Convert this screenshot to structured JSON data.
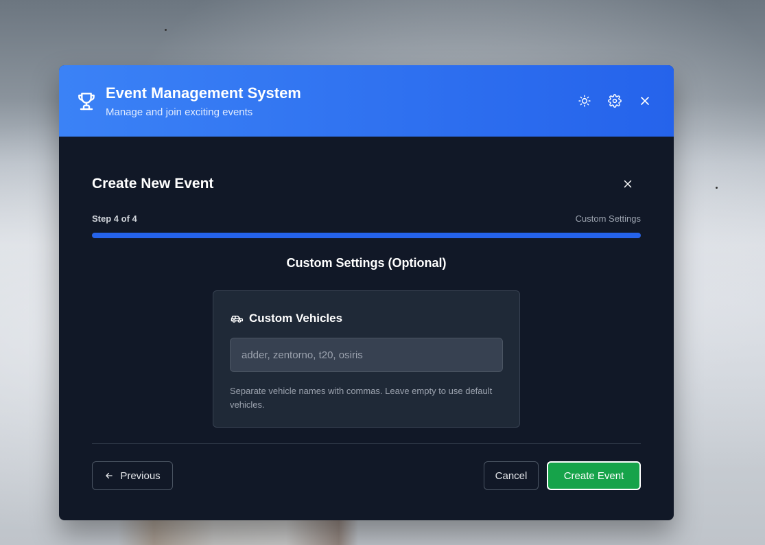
{
  "app": {
    "title": "Event Management System",
    "subtitle": "Manage and join exciting events",
    "icons": {
      "logo": "trophy-icon",
      "theme": "sun-icon",
      "settings": "gear-icon",
      "close": "close-icon"
    }
  },
  "form": {
    "title": "Create New Event",
    "step_label": "Step 4 of 4",
    "step_name": "Custom Settings",
    "progress": 1.0,
    "section_title": "Custom Settings (Optional)",
    "vehicles": {
      "icon": "car-icon",
      "title": "Custom Vehicles",
      "value": "",
      "placeholder": "adder, zentorno, t20, osiris",
      "hint": "Separate vehicle names with commas. Leave empty to use default vehicles."
    }
  },
  "buttons": {
    "previous": "Previous",
    "cancel": "Cancel",
    "create": "Create Event"
  },
  "colors": {
    "header_gradient_start": "#3b82f6",
    "header_gradient_end": "#2563eb",
    "modal_bg": "#111827",
    "card_bg": "#1f2937",
    "progress": "#2563eb",
    "primary_button": "#16a34a"
  }
}
